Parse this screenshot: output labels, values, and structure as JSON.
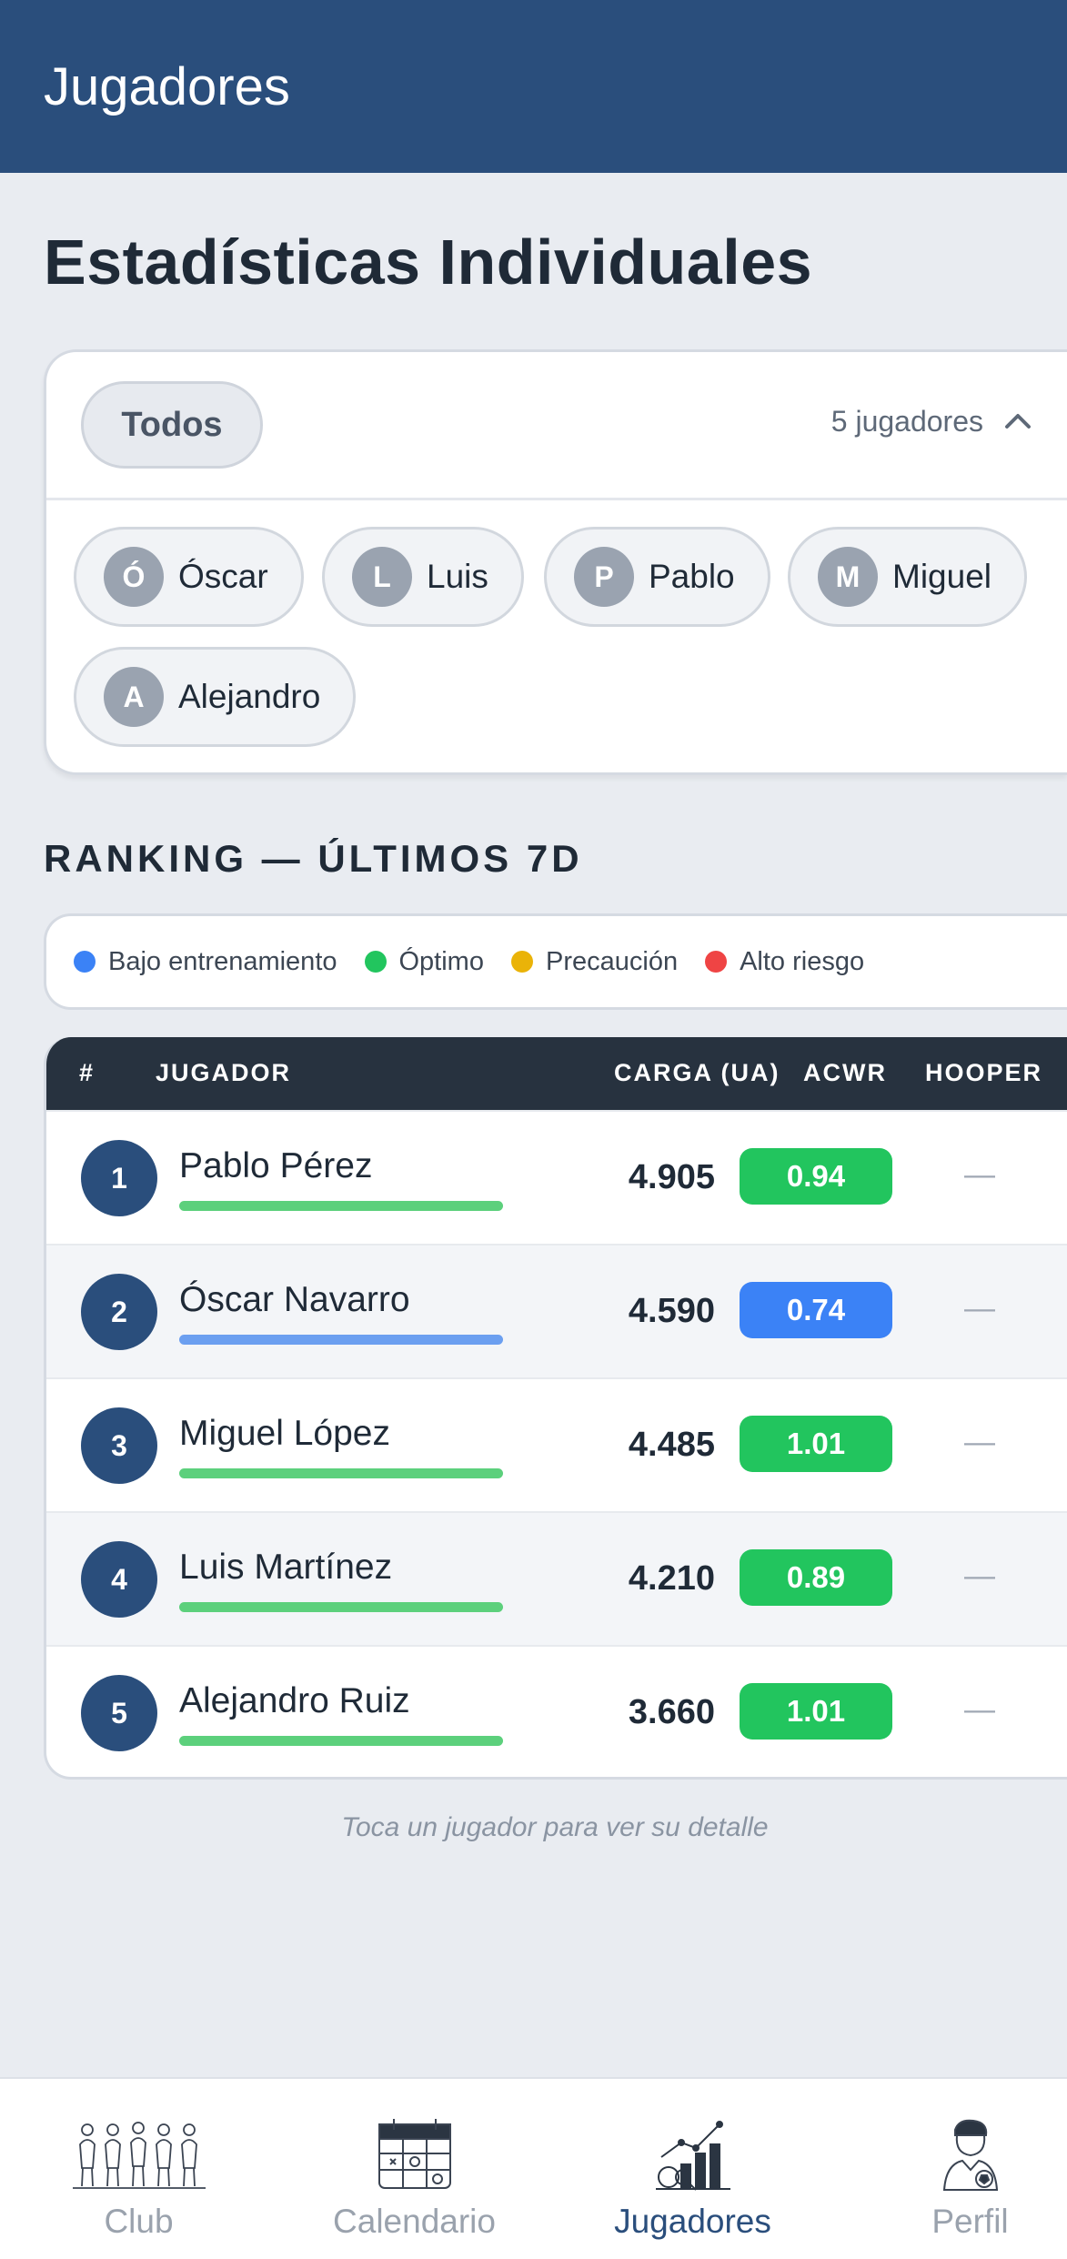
{
  "app_bar": {
    "title": "Jugadores"
  },
  "page": {
    "title": "Estadísticas Individuales"
  },
  "filter": {
    "all_label": "Todos",
    "count_label": "5 jugadores",
    "chips": [
      {
        "initial": "Ó",
        "name": "Óscar"
      },
      {
        "initial": "L",
        "name": "Luis"
      },
      {
        "initial": "P",
        "name": "Pablo"
      },
      {
        "initial": "M",
        "name": "Miguel"
      },
      {
        "initial": "A",
        "name": "Alejandro"
      }
    ]
  },
  "ranking": {
    "title": "RANKING — ÚLTIMOS 7D",
    "legend": [
      {
        "label": "Bajo entrenamiento",
        "color": "#3b82f6"
      },
      {
        "label": "Óptimo",
        "color": "#22c55e"
      },
      {
        "label": "Precaución",
        "color": "#eab308"
      },
      {
        "label": "Alto riesgo",
        "color": "#ef4444"
      }
    ],
    "columns": {
      "rank": "#",
      "player": "JUGADOR",
      "load": "CARGA (UA)",
      "acwr": "ACWR",
      "hooper": "HOOPER"
    },
    "rows": [
      {
        "rank": "1",
        "name": "Pablo Pérez",
        "load": "4.905",
        "acwr": "0.94",
        "acwr_color": "#22c55e",
        "bar_color": "#5cd07c",
        "hooper": "—"
      },
      {
        "rank": "2",
        "name": "Óscar Navarro",
        "load": "4.590",
        "acwr": "0.74",
        "acwr_color": "#3b82f6",
        "bar_color": "#6b9ff0",
        "hooper": "—"
      },
      {
        "rank": "3",
        "name": "Miguel López",
        "load": "4.485",
        "acwr": "1.01",
        "acwr_color": "#22c55e",
        "bar_color": "#5cd07c",
        "hooper": "—"
      },
      {
        "rank": "4",
        "name": "Luis Martínez",
        "load": "4.210",
        "acwr": "0.89",
        "acwr_color": "#22c55e",
        "bar_color": "#5cd07c",
        "hooper": "—"
      },
      {
        "rank": "5",
        "name": "Alejandro Ruiz",
        "load": "3.660",
        "acwr": "1.01",
        "acwr_color": "#22c55e",
        "bar_color": "#5cd07c",
        "hooper": "—"
      }
    ],
    "hint": "Toca un jugador para ver su detalle"
  },
  "bottom_nav": {
    "items": [
      {
        "label": "Club",
        "icon": "players-group-icon"
      },
      {
        "label": "Calendario",
        "icon": "calendar-icon"
      },
      {
        "label": "Jugadores",
        "icon": "stats-chart-icon"
      },
      {
        "label": "Perfil",
        "icon": "player-profile-icon"
      }
    ],
    "active": "Jugadores"
  }
}
